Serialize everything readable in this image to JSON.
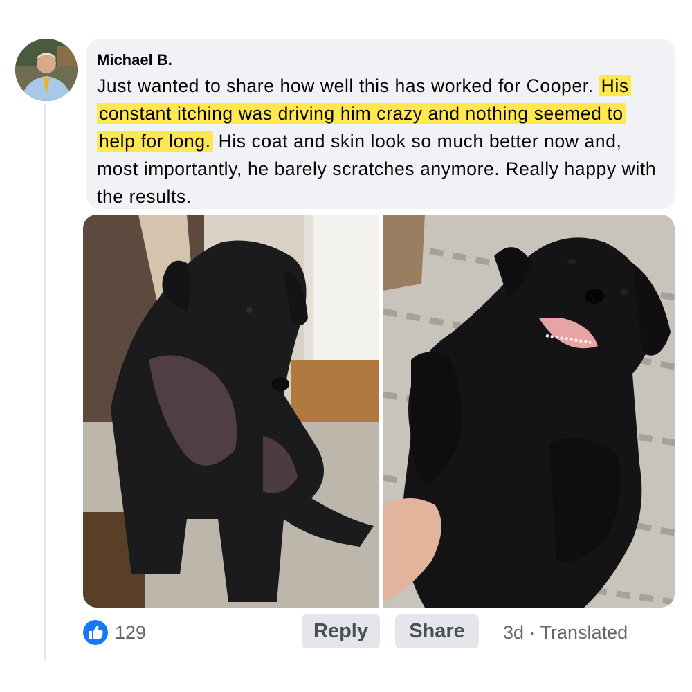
{
  "comment": {
    "author": "Michael B.",
    "text_before": "Just wanted to share how well this has worked for Cooper. ",
    "text_highlight": "His constant itching was driving him crazy and nothing seemed to help for long.",
    "text_after": " His coat and skin look so much better now and, most importantly, he barely scratches anymore. Really happy with the results.",
    "highlight_color": "#ffe84d"
  },
  "photos": [
    {
      "icon": "dog-sitting-before-photo"
    },
    {
      "icon": "dog-lying-happy-after-photo"
    }
  ],
  "footer": {
    "like_count": "129",
    "reply_label": "Reply",
    "share_label": "Share",
    "meta": "3d · Translated",
    "like_color": "#1877f2"
  }
}
